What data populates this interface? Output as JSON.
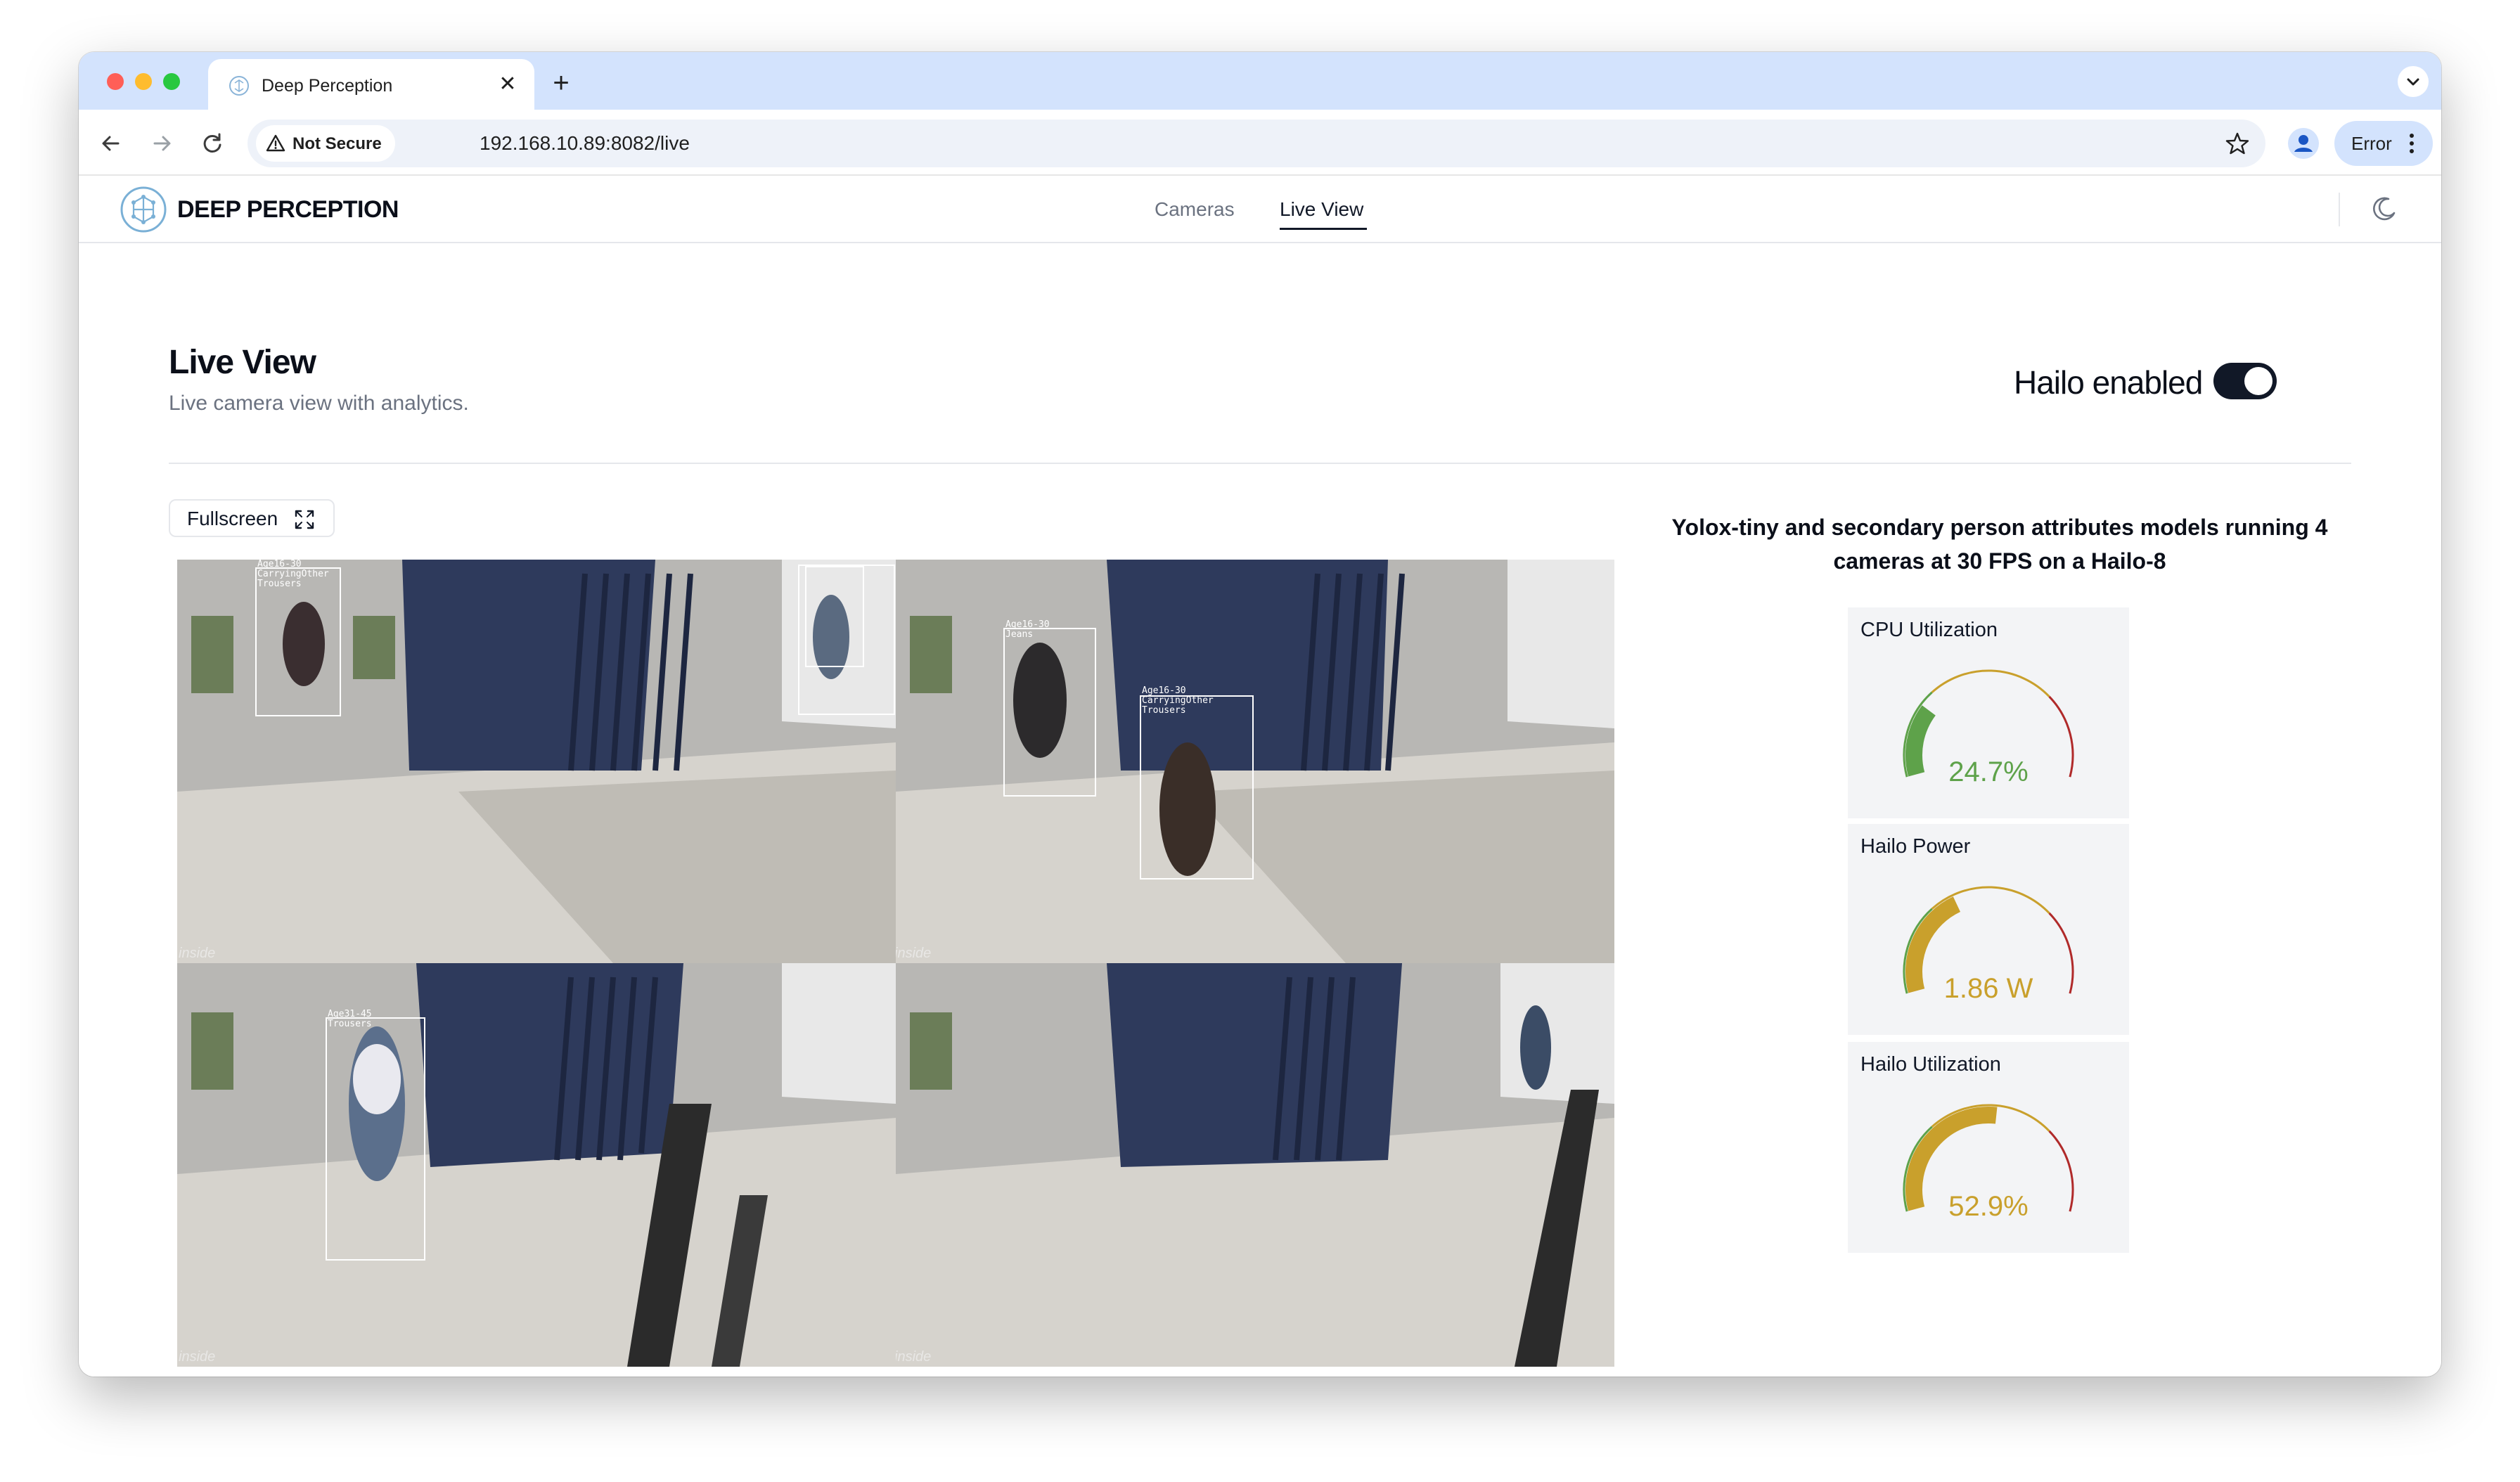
{
  "browser": {
    "tab_title": "Deep Perception",
    "tab_close_glyph": "✕",
    "new_tab_glyph": "+",
    "security_chip": "Not Secure",
    "url": "192.168.10.89:8082/live",
    "profile_status": "Error",
    "icons": [
      "back-icon",
      "forward-icon",
      "reload-icon",
      "warning-icon",
      "star-icon",
      "profile-icon",
      "kebab-icon",
      "tab-search-icon"
    ]
  },
  "header": {
    "brand": "DEEP PERCEPTION",
    "nav": [
      {
        "label": "Cameras",
        "active": false
      },
      {
        "label": "Live View",
        "active": true
      }
    ]
  },
  "page": {
    "title": "Live View",
    "subtitle": "Live camera view with analytics.",
    "hailo_toggle_label": "Hailo enabled",
    "hailo_enabled": true,
    "fullscreen_label": "Fullscreen"
  },
  "cameras": [
    {
      "watermark": "inside",
      "detections": [
        {
          "label_lines": [
            "Age16-30",
            "CarryingOther",
            "Trousers"
          ]
        },
        {
          "label_lines": []
        },
        {
          "label_lines": []
        }
      ]
    },
    {
      "watermark": "inside",
      "detections": [
        {
          "label_lines": [
            "Age16-30",
            "Jeans"
          ]
        },
        {
          "label_lines": [
            "Age16-30",
            "CarryingOther",
            "Trousers"
          ]
        }
      ]
    },
    {
      "watermark": "inside",
      "detections": [
        {
          "label_lines": [
            "Age31-45",
            "Trousers"
          ]
        }
      ]
    },
    {
      "watermark": "inside",
      "detections": []
    }
  ],
  "analytics": {
    "heading": "Yolox-tiny and secondary person attributes models running 4 cameras at 30 FPS on a Hailo-8",
    "gauges": [
      {
        "title": "CPU Utilization",
        "value_text": "24.7%",
        "fraction": 0.247,
        "color": "#5ea24a"
      },
      {
        "title": "Hailo Power",
        "value_text": "1.86 W",
        "fraction": 0.38,
        "color": "#c9a02c"
      },
      {
        "title": "Hailo Utilization",
        "value_text": "52.9%",
        "fraction": 0.529,
        "color": "#c9a02c"
      }
    ]
  },
  "colors": {
    "accent_dark": "#111827",
    "gauge_green": "#5ea24a",
    "gauge_yellow": "#c9a02c",
    "gauge_red": "#b02a2a",
    "tabstrip": "#d3e3fd"
  }
}
